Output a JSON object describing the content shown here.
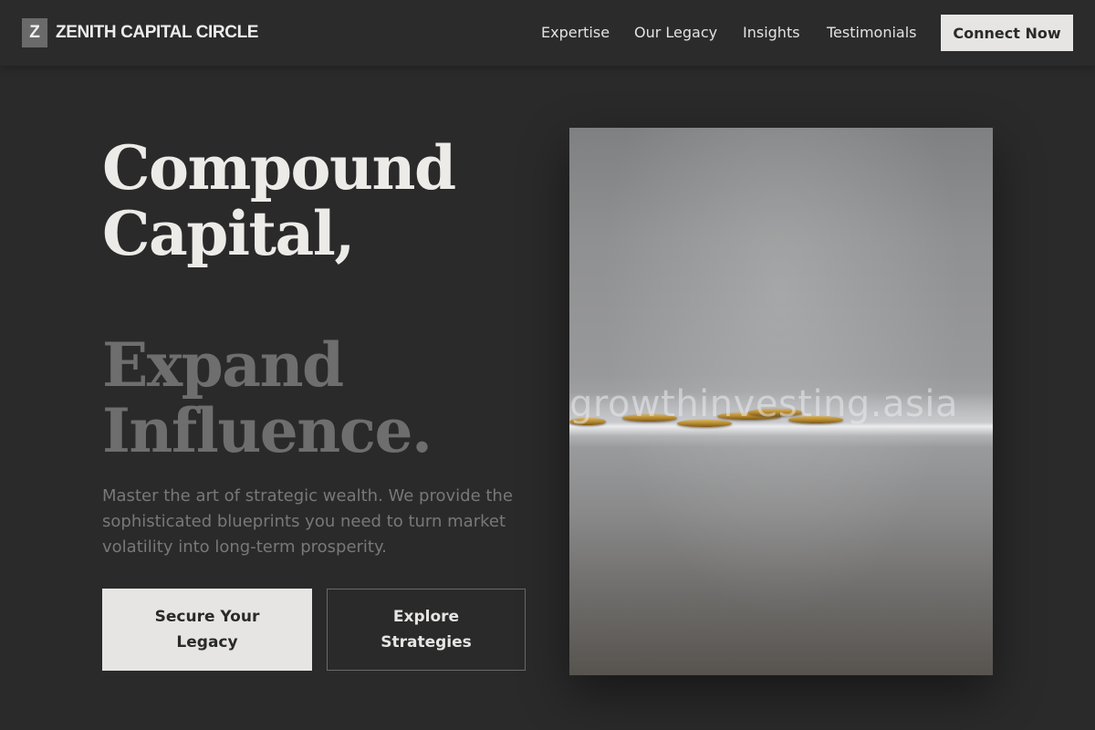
{
  "nav": {
    "logo_letter": "Z",
    "brand": "ZENITH CAPITAL CIRCLE",
    "links": [
      "Expertise",
      "Our Legacy",
      "Insights",
      "Testimonials"
    ],
    "cta": "Connect Now"
  },
  "hero": {
    "headline_line1": "Compound Capital,",
    "headline_line2": "Expand Influence.",
    "lead": "Master the art of strategic wealth. We provide the sophisticated blueprints you need to turn market volatility into long-term prosperity.",
    "primary_button": "Secure Your Legacy",
    "secondary_button": "Explore Strategies",
    "image_watermark": "growthinvesting.asia"
  },
  "colors": {
    "background": "#2a2a2a",
    "accent_light": "#e6e5e3",
    "muted_text": "#6e6e6e"
  }
}
